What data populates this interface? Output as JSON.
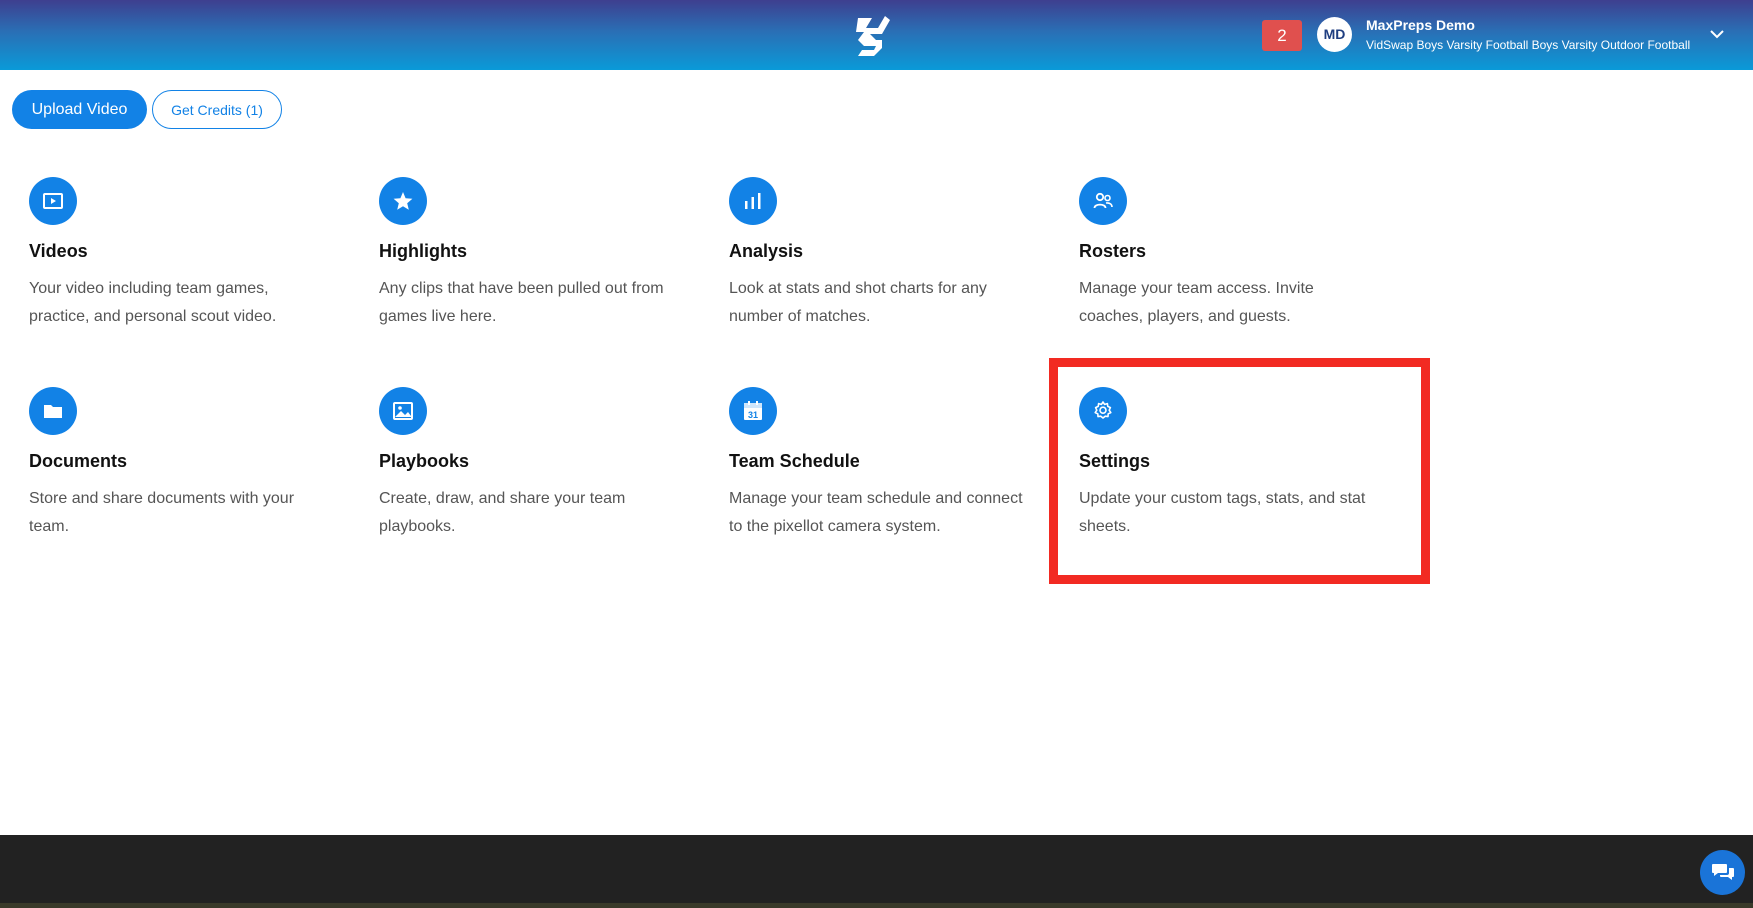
{
  "header": {
    "logo": "vidswap-logo",
    "notifications_count": "2",
    "avatar_initials": "MD",
    "user_name": "MaxPreps Demo",
    "user_team": "VidSwap Boys Varsity Football Boys Varsity Outdoor Football",
    "gradient_colors": [
      "#3e3f8f",
      "#0a9ad8"
    ]
  },
  "actions": {
    "upload_label": "Upload Video",
    "credits_label": "Get Credits (1)"
  },
  "tiles": [
    {
      "icon": "video-icon",
      "title": "Videos",
      "desc": "Your video including team games, practice, and personal scout video."
    },
    {
      "icon": "star-icon",
      "title": "Highlights",
      "desc": "Any clips that have been pulled out from games live here."
    },
    {
      "icon": "bar-chart-icon",
      "title": "Analysis",
      "desc": "Look at stats and shot charts for any number of matches."
    },
    {
      "icon": "users-icon",
      "title": "Rosters",
      "desc": "Manage your team access. Invite coaches, players, and guests."
    },
    {
      "icon": "folder-icon",
      "title": "Documents",
      "desc": "Store and share documents with your team."
    },
    {
      "icon": "image-icon",
      "title": "Playbooks",
      "desc": "Create, draw, and share your team playbooks."
    },
    {
      "icon": "calendar-icon",
      "title": "Team Schedule",
      "desc": "Manage your team schedule and connect to the pixellot camera system.",
      "calendar_day": "31"
    },
    {
      "icon": "gear-icon",
      "title": "Settings",
      "desc": "Update your custom tags, stats, and stat sheets."
    }
  ],
  "colors": {
    "accent": "#1282e6",
    "highlight": "#f22a22",
    "notification": "#e0504e",
    "footer": "#222222"
  },
  "chat": {
    "icon": "chat-icon"
  }
}
